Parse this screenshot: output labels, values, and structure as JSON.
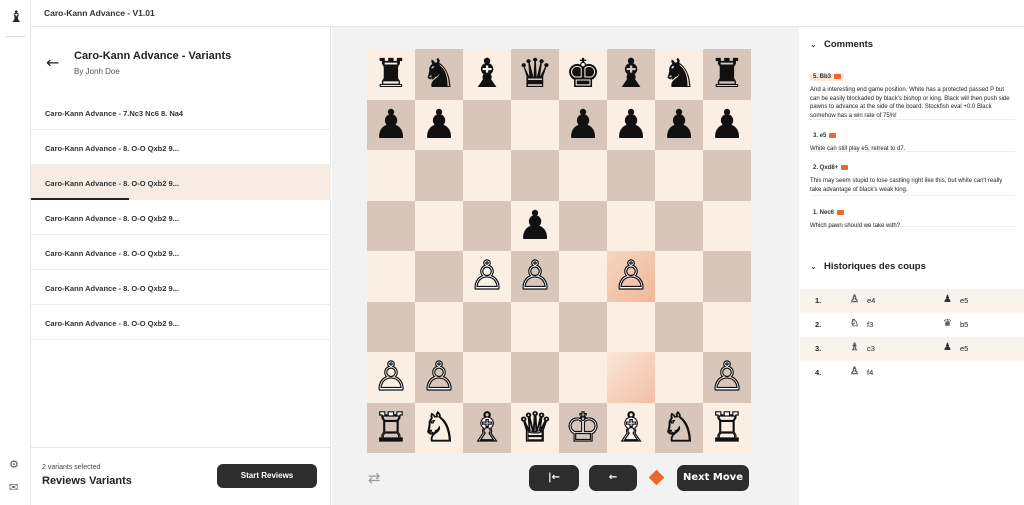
{
  "app": {
    "title": "Caro-Kann Advance - V1.01",
    "logo_icon": "bishop-logo-icon"
  },
  "rail": {
    "settings_icon": "gear-icon",
    "mail_icon": "mail-icon"
  },
  "left": {
    "title": "Caro-Kann Advance - Variants",
    "author": "By Jonh Doe",
    "variants": [
      {
        "label": "Caro-Kann Advance - 7.Nc3 Nc6 8. Na4",
        "checked": true
      },
      {
        "label": "Caro-Kann Advance - 8. O-O Qxb2 9...",
        "checked": true
      },
      {
        "label": "Caro-Kann Advance - 8. O-O Qxb2 9...",
        "checked": false,
        "selected": true
      },
      {
        "label": "Caro-Kann Advance - 8. O-O Qxb2 9...",
        "checked": false
      },
      {
        "label": "Caro-Kann Advance - 8. O-O Qxb2 9...",
        "checked": false
      },
      {
        "label": "Caro-Kann Advance - 8. O-O Qxb2 9...",
        "checked": false
      },
      {
        "label": "Caro-Kann Advance - 8. O-O Qxb2 9...",
        "checked": false
      }
    ],
    "selected_count": "2 variants selected",
    "footer_title": "Reviews Variants",
    "start_button": "Start Reviews"
  },
  "board": {
    "rows": [
      [
        "♜",
        "♞",
        "♝",
        "♛",
        "♚",
        "♝",
        "♞",
        "♜"
      ],
      [
        "♟",
        "♟",
        "",
        "",
        "♟",
        "♟",
        "♟",
        "♟"
      ],
      [
        "",
        "",
        "",
        "",
        "",
        "",
        "",
        ""
      ],
      [
        "",
        "",
        "",
        "♟",
        "",
        "",
        "",
        ""
      ],
      [
        "",
        "",
        "♙",
        "♙",
        "",
        "♙",
        "",
        ""
      ],
      [
        "",
        "",
        "",
        "",
        "",
        "",
        "",
        ""
      ],
      [
        "♙",
        "♙",
        "",
        "",
        "",
        "",
        "",
        "♙"
      ],
      [
        "♖",
        "♘",
        "♗",
        "♕",
        "♔",
        "♗",
        "♘",
        "♖"
      ]
    ],
    "highlights": {
      "4-5": "hl1",
      "6-5": "hl2"
    }
  },
  "controls": {
    "flip_icon": "flip-board-icon",
    "first_label": "|←",
    "prev_label": "←",
    "next_label": "Next Move",
    "accent": "#e8692b"
  },
  "comments": {
    "title": "Comments",
    "items": [
      {
        "tag": "5. Bb3",
        "hot": true,
        "text": "And a interesting end game position. White has a protected passed P but can be easily blockaded by black's bishop or king. Black will then push side pawns to advance at the side of the board. Stockfish eval +0.0 Black somehow has a win rate of 75%!"
      },
      {
        "tag": "3. e5",
        "hot": false,
        "text": "White can still play e5, retreat to d7."
      },
      {
        "tag": "2. Qxd8+",
        "hot": false,
        "text": "This may seem stupid to lose castling right like this, but white can't really take advantage of black's weak king."
      },
      {
        "tag": "1. Nec6",
        "hot": false,
        "text": "Which pawn should we take with?"
      }
    ]
  },
  "history": {
    "title": "Historiques des coups",
    "moves": [
      {
        "n": "1.",
        "w_piece": "♙",
        "w": "e4",
        "b_piece": "♟",
        "b": "e5"
      },
      {
        "n": "2.",
        "w_piece": "♘",
        "w": "f3",
        "b_piece": "♛",
        "b": "b5"
      },
      {
        "n": "3.",
        "w_piece": "♗",
        "w": "c3",
        "b_piece": "♟",
        "b": "e5"
      },
      {
        "n": "4.",
        "w_piece": "♙",
        "w": "f4",
        "b_piece": "",
        "b": ""
      }
    ]
  }
}
